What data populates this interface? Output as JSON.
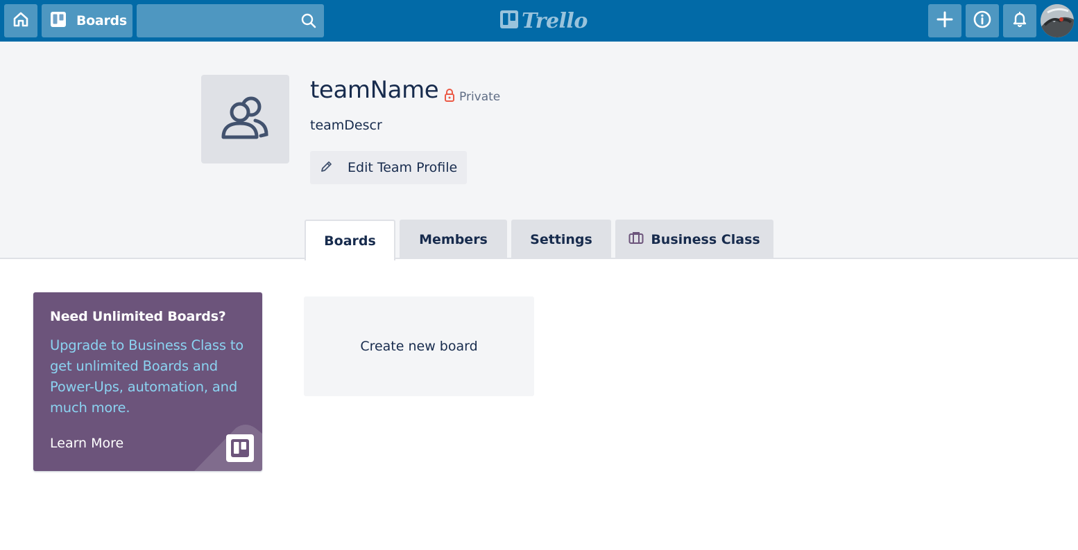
{
  "header": {
    "home_icon": "home-icon",
    "boards_label": "Boards",
    "search_placeholder": "",
    "logo_text": "Trello",
    "colors": {
      "bar": "#026aa7",
      "button": "rgba(255,255,255,0.3)"
    }
  },
  "team": {
    "name": "teamName",
    "privacy_label": "Private",
    "description": "teamDescr",
    "edit_label": "Edit Team Profile",
    "colors": {
      "lock": "#eb5a46"
    }
  },
  "tabs": [
    {
      "label": "Boards",
      "active": true
    },
    {
      "label": "Members",
      "active": false
    },
    {
      "label": "Settings",
      "active": false
    },
    {
      "label": "Business Class",
      "active": false
    }
  ],
  "promo": {
    "title": "Need Unlimited Boards?",
    "body": "Upgrade to Business Class to get unlimited Boards and Power-Ups, automation, and much more.",
    "link": "Learn More",
    "colors": {
      "background": "#6c547b",
      "body_text": "#8bd3f1"
    }
  },
  "create_board": {
    "label": "Create new board"
  }
}
